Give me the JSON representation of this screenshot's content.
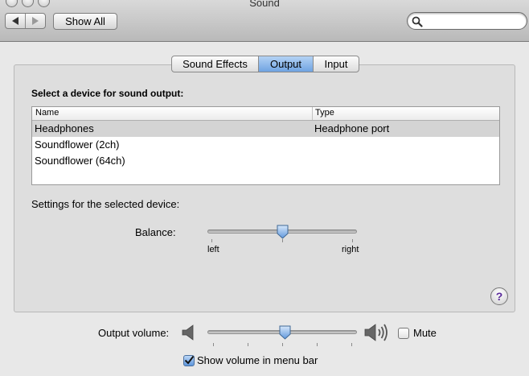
{
  "window": {
    "title": "Sound"
  },
  "toolbar": {
    "show_all_label": "Show All",
    "search_value": ""
  },
  "tabs": [
    {
      "label": "Sound Effects",
      "active": false
    },
    {
      "label": "Output",
      "active": true
    },
    {
      "label": "Input",
      "active": false
    }
  ],
  "output": {
    "heading": "Select a device for sound output:",
    "columns": [
      "Name",
      "Type"
    ],
    "devices": [
      {
        "name": "Headphones",
        "type": "Headphone port",
        "selected": true
      },
      {
        "name": "Soundflower (2ch)",
        "type": "",
        "selected": false
      },
      {
        "name": "Soundflower (64ch)",
        "type": "",
        "selected": false
      }
    ],
    "settings_label": "Settings for the selected device:",
    "balance": {
      "label": "Balance:",
      "left_label": "left",
      "right_label": "right",
      "value": 0.5
    }
  },
  "help_label": "?",
  "volume": {
    "label": "Output volume:",
    "value": 0.52
  },
  "mute": {
    "label": "Mute",
    "checked": false
  },
  "menu_bar": {
    "label": "Show volume in menu bar",
    "checked": true
  },
  "colors": {
    "selected_tab": "#6fa3e2",
    "selected_row": "#d4d4d4",
    "checkbox_on": "#5d96dd"
  }
}
